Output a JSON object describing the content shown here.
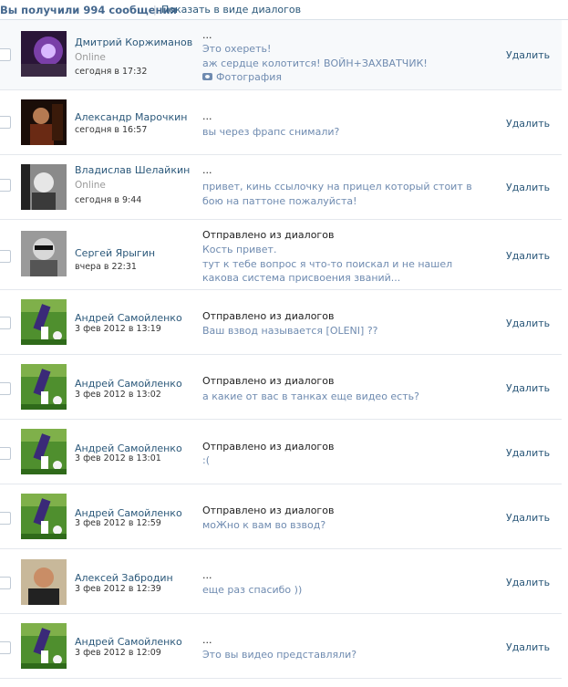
{
  "header": {
    "count_text": "Вы получили 994 сообщения",
    "separator": "|",
    "dialogs_link": "Показать в виде диалогов"
  },
  "delete_label": "Удалить",
  "messages": [
    {
      "name": "Дмитрий Коржиманов",
      "status": "Online",
      "date": "сегодня в 17:32",
      "subject": "...",
      "body": "Это охереть!\nаж сердце колотится! ВОЙН+ЗАХВАТЧИК!",
      "attachment": "Фотография",
      "avatar": "purple-glow"
    },
    {
      "name": "Александр Марочкин",
      "status": "",
      "date": "сегодня в 16:57",
      "subject": "...",
      "body": "вы через фрапс снимали?",
      "attachment": "",
      "avatar": "dark-red"
    },
    {
      "name": "Владислав Шелайкин",
      "status": "Online",
      "date": "сегодня в 9:44",
      "subject": "...",
      "body": "привет, кинь ссылочку на прицел который стоит в бою на паттоне пожалуйста!",
      "attachment": "",
      "avatar": "bw-portrait"
    },
    {
      "name": "Сергей Ярыгин",
      "status": "",
      "date": "вчера в 22:31",
      "subject": "Отправлено из диалогов",
      "body": "Кость привет.\nтут к тебе вопрос я что-то поискал и не нашел какова система присвоения званий...",
      "attachment": "",
      "avatar": "sunglasses"
    },
    {
      "name": "Андрей Самойленко",
      "status": "",
      "date": "3 фев 2012 в 13:19",
      "subject": "Отправлено из диалогов",
      "body": "Ваш взвод называется [OLENI] ??",
      "attachment": "",
      "avatar": "football"
    },
    {
      "name": "Андрей Самойленко",
      "status": "",
      "date": "3 фев 2012 в 13:02",
      "subject": "Отправлено из диалогов",
      "body": "а какие от вас в танках еще видео есть?",
      "attachment": "",
      "avatar": "football"
    },
    {
      "name": "Андрей Самойленко",
      "status": "",
      "date": "3 фев 2012 в 13:01",
      "subject": "Отправлено из диалогов",
      "body": ":(",
      "attachment": "",
      "avatar": "football"
    },
    {
      "name": "Андрей Самойленко",
      "status": "",
      "date": "3 фев 2012 в 12:59",
      "subject": "Отправлено из диалогов",
      "body": "моЖно к вам во взвод?",
      "attachment": "",
      "avatar": "football"
    },
    {
      "name": "Алексей Забродин",
      "status": "",
      "date": "3 фев 2012 в 12:39",
      "subject": "...",
      "body": "еще раз спасибо ))",
      "attachment": "",
      "avatar": "man-photo"
    },
    {
      "name": "Андрей Самойленко",
      "status": "",
      "date": "3 фев 2012 в 12:09",
      "subject": "...",
      "body": "Это вы видео представляли?",
      "attachment": "",
      "avatar": "football"
    }
  ]
}
